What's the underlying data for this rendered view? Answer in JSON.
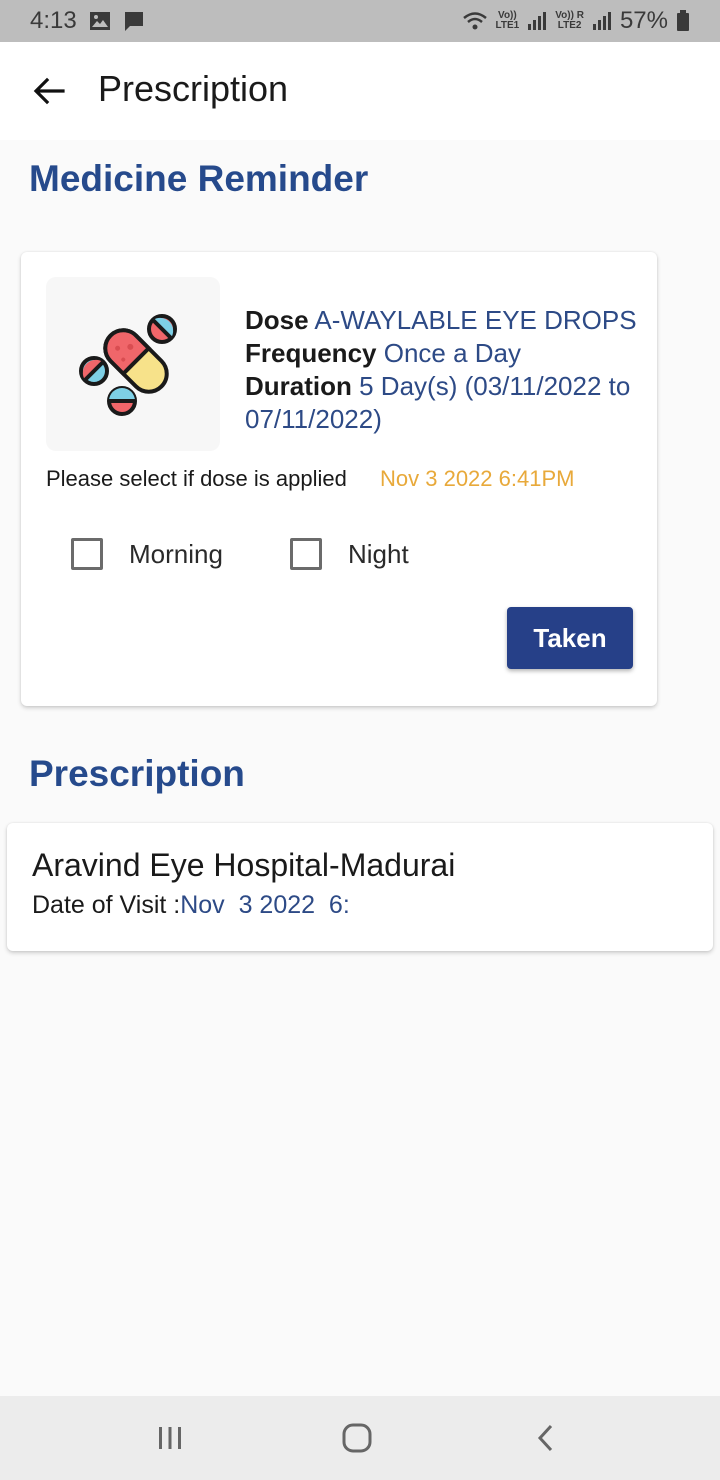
{
  "status_bar": {
    "time": "4:13",
    "lte1": "LTE1",
    "lte2": "LTE2",
    "volte": "Vo))",
    "roaming": "R",
    "battery": "57%"
  },
  "app_bar": {
    "title": "Prescription"
  },
  "reminder": {
    "section_title": "Medicine Reminder",
    "dose_label": "Dose",
    "dose_value": "A-WAYLABLE EYE DROPS",
    "frequency_label": "Frequency",
    "frequency_value": "Once a Day",
    "duration_label": "Duration",
    "duration_value": "5 Day(s) (03/11/2022 to 07/11/2022)",
    "select_prompt": "Please select if dose is applied",
    "select_datetime": "Nov 3 2022 6:41PM",
    "checkbox_morning": "Morning",
    "checkbox_night": "Night",
    "taken_label": "Taken"
  },
  "prescription": {
    "section_title": "Prescription",
    "hospital": "Aravind Eye Hospital-Madurai",
    "visit_label": "Date of Visit :",
    "visit_value": "Nov  3 2022  6:"
  },
  "colors": {
    "accent": "#264a8c",
    "button": "#264088",
    "date_highlight": "#e8a93a"
  },
  "icons": {
    "back": "arrow-left-icon",
    "medicine": "pills-icon",
    "nav_recents": "recents-icon",
    "nav_home": "home-icon",
    "nav_back": "chevron-left-icon"
  }
}
